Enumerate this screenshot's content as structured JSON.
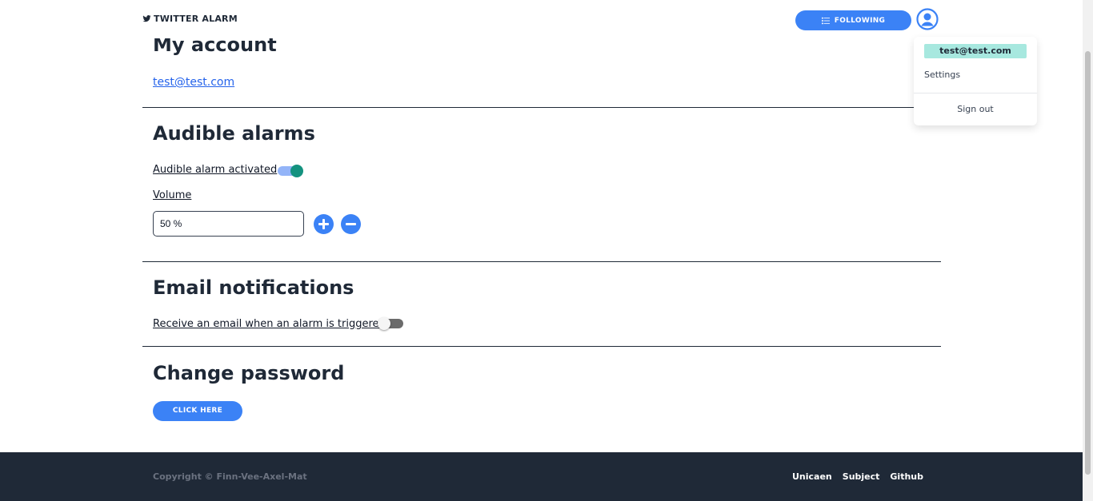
{
  "header": {
    "brand": "TWITTER ALARM",
    "following_label": "FOLLOWING"
  },
  "dropdown": {
    "email": "test@test.com",
    "settings": "Settings",
    "signout": "Sign out"
  },
  "account": {
    "title": "My account",
    "email": "test@test.com"
  },
  "audible": {
    "title": "Audible alarms",
    "activated_label": "Audible alarm activated",
    "activated": true,
    "volume_label": "Volume",
    "volume_value": "50 %"
  },
  "email_notifications": {
    "title": "Email notifications",
    "label": "Receive an email when an alarm is triggered",
    "enabled": false
  },
  "password": {
    "title": "Change password",
    "button": "CLICK HERE"
  },
  "footer": {
    "copyright": "Copyright © Finn-Vee-Axel-Mat",
    "links": [
      "Unicaen",
      "Subject",
      "Github"
    ]
  },
  "colors": {
    "primary": "#3b82f6",
    "toggle_on": "#14927f",
    "badge": "#a7e8df",
    "footer_bg": "#1f2937"
  }
}
